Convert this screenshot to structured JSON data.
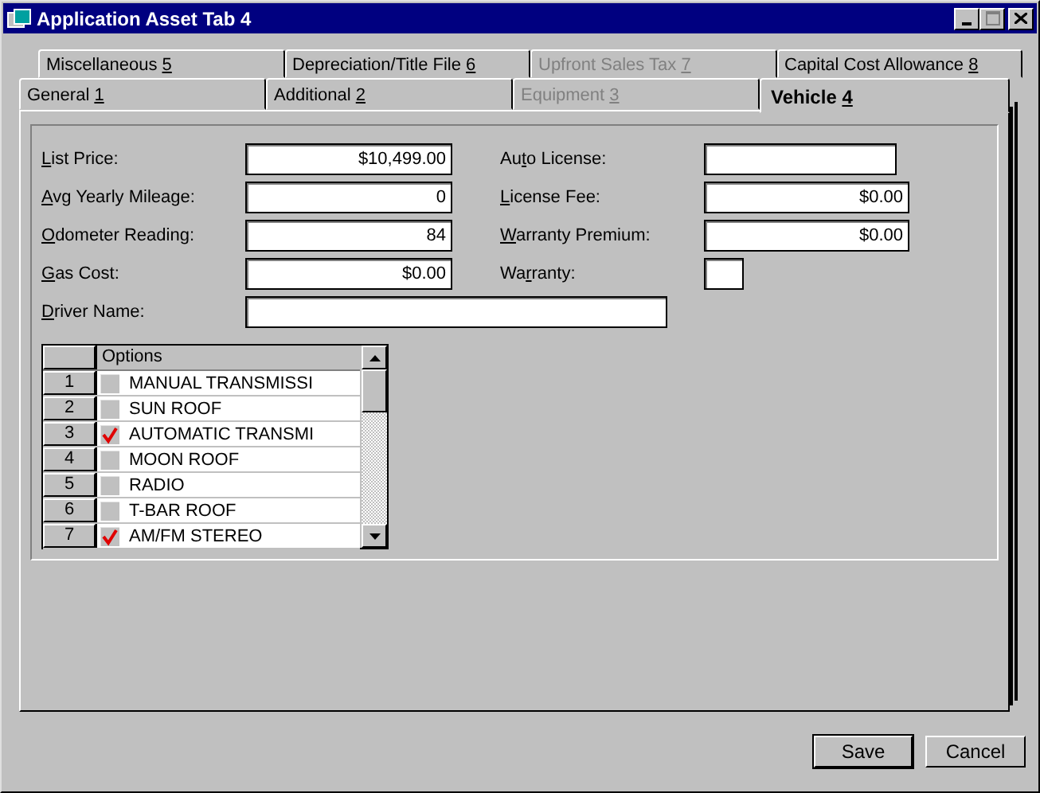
{
  "window": {
    "title": "Application Asset Tab 4"
  },
  "tab_rows": [
    [
      {
        "pre": "Miscellaneous ",
        "key": "5",
        "selected": false,
        "disabled": false
      },
      {
        "pre": "Depreciation/Title File ",
        "key": "6",
        "selected": false,
        "disabled": false
      },
      {
        "pre": "Upfront Sales Tax ",
        "key": "7",
        "selected": false,
        "disabled": true
      },
      {
        "pre": "Capital Cost Allowance ",
        "key": "8",
        "selected": false,
        "disabled": false
      }
    ],
    [
      {
        "pre": "General ",
        "key": "1",
        "selected": false,
        "disabled": false
      },
      {
        "pre": "Additional ",
        "key": "2",
        "selected": false,
        "disabled": false
      },
      {
        "pre": "Equipment ",
        "key": "3",
        "selected": false,
        "disabled": true
      },
      {
        "pre": "Vehicle ",
        "key": "4",
        "selected": true,
        "disabled": false
      }
    ]
  ],
  "left_fields": [
    {
      "key": "L",
      "post": "ist Price:",
      "value": "$10,499.00"
    },
    {
      "key": "A",
      "post": "vg Yearly Mileage:",
      "value": "0"
    },
    {
      "key": "O",
      "post": "dometer Reading:",
      "value": "84"
    },
    {
      "key": "G",
      "post": "as Cost:",
      "value": "$0.00"
    }
  ],
  "right_fields": [
    {
      "pre": "Au",
      "key": "t",
      "post": "o License:",
      "kind": "short"
    },
    {
      "key": "L",
      "post": "icense Fee:",
      "value": "$0.00",
      "kind": "wide"
    },
    {
      "key": "W",
      "post": "arranty Premium:",
      "value": "$0.00",
      "kind": "wide"
    },
    {
      "pre": "Wa",
      "key": "r",
      "post": "ranty:",
      "kind": "check"
    }
  ],
  "driver_name": {
    "key": "D",
    "post": "river Name:"
  },
  "options_grid": {
    "column": "Options",
    "rows": [
      {
        "number": "1",
        "text": "MANUAL TRANSMISSI",
        "checked": false
      },
      {
        "number": "2",
        "text": "SUN ROOF",
        "checked": false
      },
      {
        "number": "3",
        "text": "AUTOMATIC TRANSMI",
        "checked": true
      },
      {
        "number": "4",
        "text": "MOON ROOF",
        "checked": false
      },
      {
        "number": "5",
        "text": "RADIO",
        "checked": false
      },
      {
        "number": "6",
        "text": "T-BAR ROOF",
        "checked": false
      },
      {
        "number": "7",
        "text": "AM/FM STEREO",
        "checked": true
      }
    ]
  },
  "buttons": [
    "Save",
    "Cancel"
  ]
}
